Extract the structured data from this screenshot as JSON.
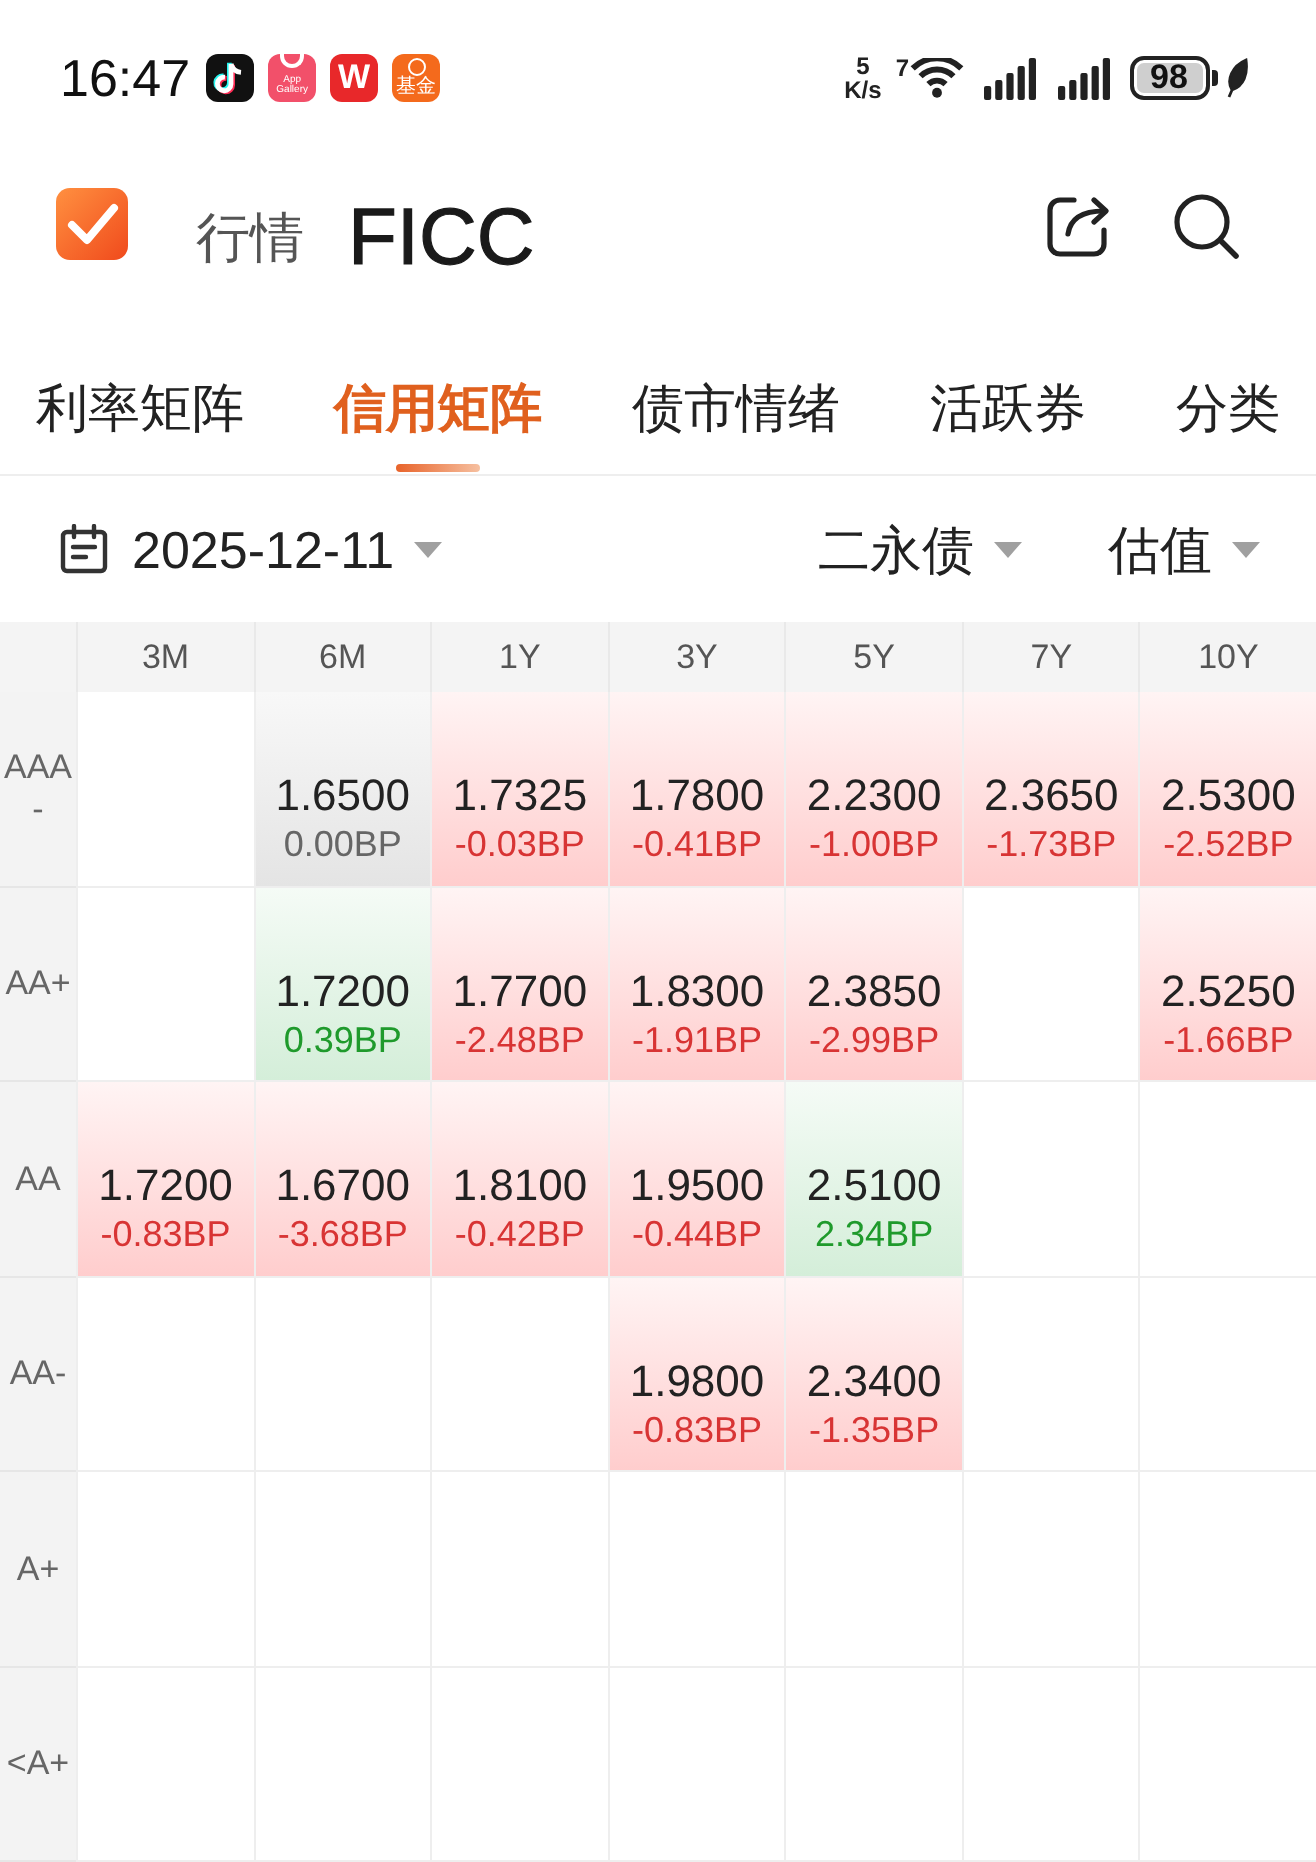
{
  "status_bar": {
    "time": "16:47",
    "app_icons": [
      {
        "kind": "music_note"
      },
      {
        "kind": "store",
        "label": "App Gallery"
      },
      {
        "kind": "letter",
        "label": "W"
      },
      {
        "kind": "fund",
        "label": "基金"
      }
    ],
    "net_speed": {
      "value": "5",
      "unit": "K/s"
    },
    "wifi_label": "7",
    "battery": "98"
  },
  "header": {
    "section": "行情",
    "title": "FICC"
  },
  "tabs": [
    {
      "label": "利率矩阵",
      "selected": false
    },
    {
      "label": "信用矩阵",
      "selected": true
    },
    {
      "label": "债市情绪",
      "selected": false
    },
    {
      "label": "活跃券",
      "selected": false
    },
    {
      "label": "分类",
      "selected": false
    }
  ],
  "filters": [
    {
      "kind": "date",
      "label": "2025-12-11"
    },
    {
      "kind": "dropdown",
      "label": "二永债"
    },
    {
      "kind": "dropdown",
      "label": "估值"
    }
  ],
  "table": {
    "columns": [
      "3M",
      "6M",
      "1Y",
      "3Y",
      "5Y",
      "7Y",
      "10Y"
    ],
    "rows": [
      {
        "rating": "AAA-",
        "cells": [
          null,
          {
            "yield": "1.6500",
            "change": "0.00BP",
            "kind": "flat"
          },
          {
            "yield": "1.7325",
            "change": "-0.03BP",
            "kind": "fall"
          },
          {
            "yield": "1.7800",
            "change": "-0.41BP",
            "kind": "fall"
          },
          {
            "yield": "2.2300",
            "change": "-1.00BP",
            "kind": "fall"
          },
          {
            "yield": "2.3650",
            "change": "-1.73BP",
            "kind": "fall"
          },
          {
            "yield": "2.5300",
            "change": "-2.52BP",
            "kind": "fall"
          }
        ]
      },
      {
        "rating": "AA+",
        "cells": [
          null,
          {
            "yield": "1.7200",
            "change": "0.39BP",
            "kind": "rise"
          },
          {
            "yield": "1.7700",
            "change": "-2.48BP",
            "kind": "fall"
          },
          {
            "yield": "1.8300",
            "change": "-1.91BP",
            "kind": "fall"
          },
          {
            "yield": "2.3850",
            "change": "-2.99BP",
            "kind": "fall"
          },
          null,
          {
            "yield": "2.5250",
            "change": "-1.66BP",
            "kind": "fall"
          }
        ]
      },
      {
        "rating": "AA",
        "cells": [
          {
            "yield": "1.7200",
            "change": "-0.83BP",
            "kind": "fall"
          },
          {
            "yield": "1.6700",
            "change": "-3.68BP",
            "kind": "fall"
          },
          {
            "yield": "1.8100",
            "change": "-0.42BP",
            "kind": "fall"
          },
          {
            "yield": "1.9500",
            "change": "-0.44BP",
            "kind": "fall"
          },
          {
            "yield": "2.5100",
            "change": "2.34BP",
            "kind": "rise"
          },
          null,
          null
        ]
      },
      {
        "rating": "AA-",
        "cells": [
          null,
          null,
          null,
          {
            "yield": "1.9800",
            "change": "-0.83BP",
            "kind": "fall"
          },
          {
            "yield": "2.3400",
            "change": "-1.35BP",
            "kind": "fall"
          },
          null,
          null
        ]
      },
      {
        "rating": "A+",
        "cells": [
          null,
          null,
          null,
          null,
          null,
          null,
          null
        ]
      },
      {
        "rating": "<A+",
        "cells": [
          null,
          null,
          null,
          null,
          null,
          null,
          null
        ]
      }
    ]
  }
}
